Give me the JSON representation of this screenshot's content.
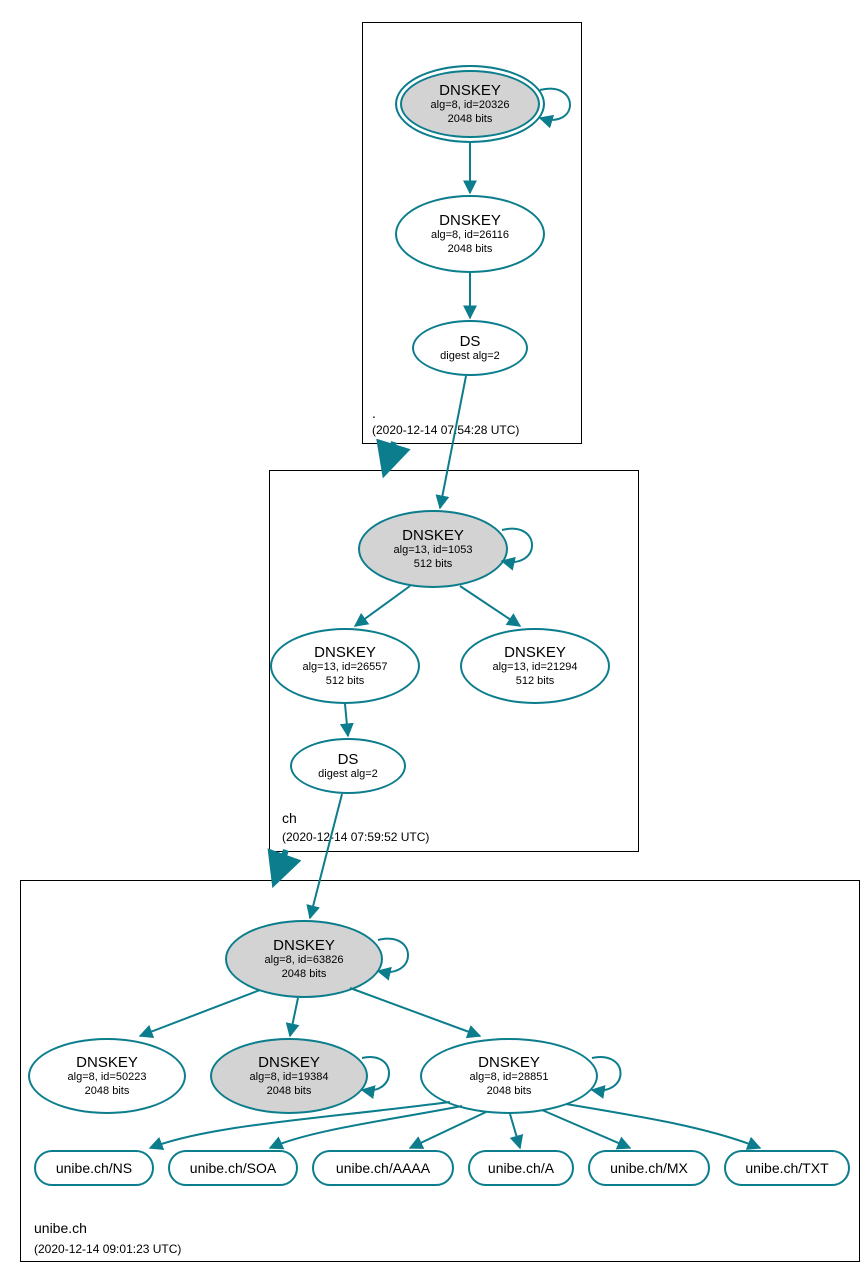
{
  "zones": {
    "root": {
      "label": ".",
      "timestamp": "(2020-12-14 07:54:28 UTC)",
      "nodes": {
        "k1": {
          "title": "DNSKEY",
          "line2": "alg=8, id=20326",
          "line3": "2048 bits"
        },
        "k2": {
          "title": "DNSKEY",
          "line2": "alg=8, id=26116",
          "line3": "2048 bits"
        },
        "ds": {
          "title": "DS",
          "line2": "digest alg=2"
        }
      }
    },
    "ch": {
      "label": "ch",
      "timestamp": "(2020-12-14 07:59:52 UTC)",
      "nodes": {
        "k1": {
          "title": "DNSKEY",
          "line2": "alg=13, id=1053",
          "line3": "512 bits"
        },
        "k2": {
          "title": "DNSKEY",
          "line2": "alg=13, id=26557",
          "line3": "512 bits"
        },
        "k3": {
          "title": "DNSKEY",
          "line2": "alg=13, id=21294",
          "line3": "512 bits"
        },
        "ds": {
          "title": "DS",
          "line2": "digest alg=2"
        }
      }
    },
    "unibe": {
      "label": "unibe.ch",
      "timestamp": "(2020-12-14 09:01:23 UTC)",
      "nodes": {
        "k1": {
          "title": "DNSKEY",
          "line2": "alg=8, id=63826",
          "line3": "2048 bits"
        },
        "k2": {
          "title": "DNSKEY",
          "line2": "alg=8, id=50223",
          "line3": "2048 bits"
        },
        "k3": {
          "title": "DNSKEY",
          "line2": "alg=8, id=19384",
          "line3": "2048 bits"
        },
        "k4": {
          "title": "DNSKEY",
          "line2": "alg=8, id=28851",
          "line3": "2048 bits"
        }
      },
      "rr": {
        "ns": "unibe.ch/NS",
        "soa": "unibe.ch/SOA",
        "aaaa": "unibe.ch/AAAA",
        "a": "unibe.ch/A",
        "mx": "unibe.ch/MX",
        "txt": "unibe.ch/TXT"
      }
    }
  },
  "colors": {
    "edge": "#0b7d8c",
    "node_border": "#0b7d8c",
    "shaded": "#d3d3d3"
  }
}
